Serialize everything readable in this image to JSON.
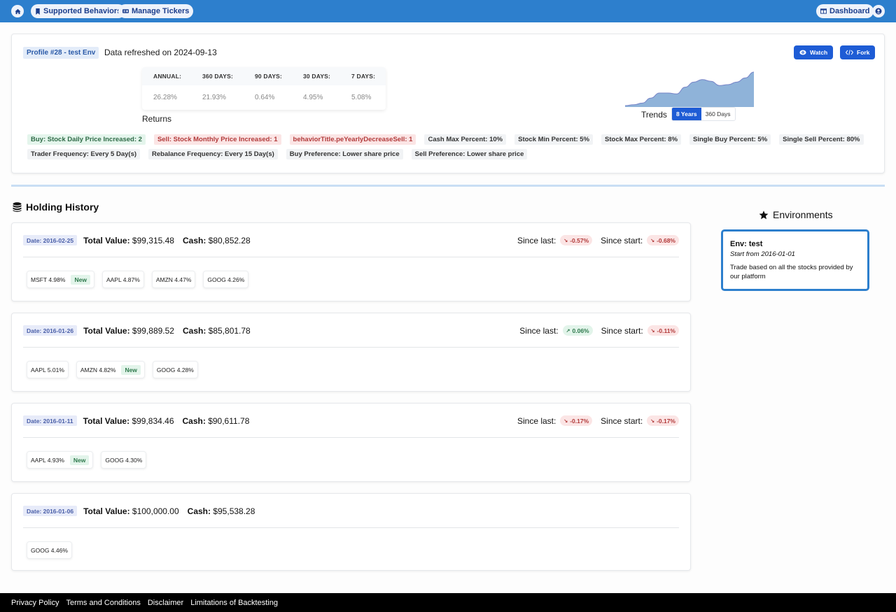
{
  "topnav": {
    "home_icon": "home-icon",
    "supported_behaviors": "Supported Behaviors",
    "manage_tickers": "Manage Tickers",
    "dashboard": "Dashboard",
    "account_icon": "user-circle-icon",
    "bar_color": "#2d7fcd"
  },
  "profile": {
    "badge": "Profile #28 - test Env",
    "refresh": "Data refreshed on 2024-09-13",
    "watch_label": "Watch",
    "fork_label": "Fork",
    "returns": {
      "headers": [
        "ANNUAL:",
        "360 DAYS:",
        "90 DAYS:",
        "30 DAYS:",
        "7 DAYS:"
      ],
      "values": [
        "26.28%",
        "21.93%",
        "0.64%",
        "4.95%",
        "5.08%"
      ],
      "caption": "Returns"
    },
    "trends": {
      "label": "Trends",
      "options": [
        "8 Years",
        "360 Days"
      ],
      "selected": "8 Years",
      "series": [
        0,
        1,
        3,
        9,
        15,
        15,
        14,
        22,
        28,
        31,
        29,
        24,
        25,
        28,
        33,
        40
      ],
      "fill_color": "#8fb3d9",
      "line_color": "#7784c7"
    },
    "tags_row1": [
      {
        "text": "Buy: Stock Daily Price Increased: 2",
        "tone": "green"
      },
      {
        "text": "Sell: Stock Monthly Price Increased: 1",
        "tone": "red"
      },
      {
        "text": "behaviorTitle.peYearlyDecreaseSell: 1",
        "tone": "red"
      },
      {
        "text": "Cash Max Percent: 10%",
        "tone": "gray"
      },
      {
        "text": "Stock Min Percent: 5%",
        "tone": "gray"
      },
      {
        "text": "Stock Max Percent: 8%",
        "tone": "gray"
      },
      {
        "text": "Single Buy Percent: 5%",
        "tone": "gray"
      },
      {
        "text": "Single Sell Percent: 80%",
        "tone": "gray"
      }
    ],
    "tags_row2": [
      {
        "text": "Trader Frequency: Every 5 Day(s)",
        "tone": "gray"
      },
      {
        "text": "Rebalance Frequency: Every 15 Day(s)",
        "tone": "gray"
      },
      {
        "text": "Buy Preference: Lower share price",
        "tone": "gray"
      },
      {
        "text": "Sell Preference: Lower share price",
        "tone": "gray"
      }
    ]
  },
  "holding_history": {
    "title": "Holding History",
    "total_label": "Total Value:",
    "cash_label": "Cash:",
    "since_last_label": "Since last:",
    "since_start_label": "Since start:",
    "new_label": "New",
    "entries": [
      {
        "date": "Date: 2016-02-25",
        "total": "$99,315.48",
        "cash": "$80,852.28",
        "since_last": {
          "value": "-0.57%",
          "dir": "down"
        },
        "since_start": {
          "value": "-0.68%",
          "dir": "down"
        },
        "holdings": [
          {
            "text": "MSFT 4.98%",
            "new": true
          },
          {
            "text": "AAPL 4.87%",
            "new": false
          },
          {
            "text": "AMZN 4.47%",
            "new": false
          },
          {
            "text": "GOOG 4.26%",
            "new": false
          }
        ]
      },
      {
        "date": "Date: 2016-01-26",
        "total": "$99,889.52",
        "cash": "$85,801.78",
        "since_last": {
          "value": "0.06%",
          "dir": "up"
        },
        "since_start": {
          "value": "-0.11%",
          "dir": "down"
        },
        "holdings": [
          {
            "text": "AAPL 5.01%",
            "new": false
          },
          {
            "text": "AMZN 4.82%",
            "new": true
          },
          {
            "text": "GOOG 4.28%",
            "new": false
          }
        ]
      },
      {
        "date": "Date: 2016-01-11",
        "total": "$99,834.46",
        "cash": "$90,611.78",
        "since_last": {
          "value": "-0.17%",
          "dir": "down"
        },
        "since_start": {
          "value": "-0.17%",
          "dir": "down"
        },
        "holdings": [
          {
            "text": "AAPL 4.93%",
            "new": true
          },
          {
            "text": "GOOG 4.30%",
            "new": false
          }
        ]
      },
      {
        "date": "Date: 2016-01-06",
        "total": "$100,000.00",
        "cash": "$95,538.28",
        "since_last": null,
        "since_start": null,
        "holdings": [
          {
            "text": "GOOG 4.46%",
            "new": false
          }
        ]
      }
    ]
  },
  "environments": {
    "title": "Environments",
    "card": {
      "name": "Env: test",
      "start": "Start from 2016-01-01",
      "description": "Trade based on all the stocks provided by our platform"
    }
  },
  "footer": {
    "links": [
      "Privacy Policy",
      "Terms and Conditions",
      "Disclaimer",
      "Limitations of Backtesting"
    ]
  }
}
